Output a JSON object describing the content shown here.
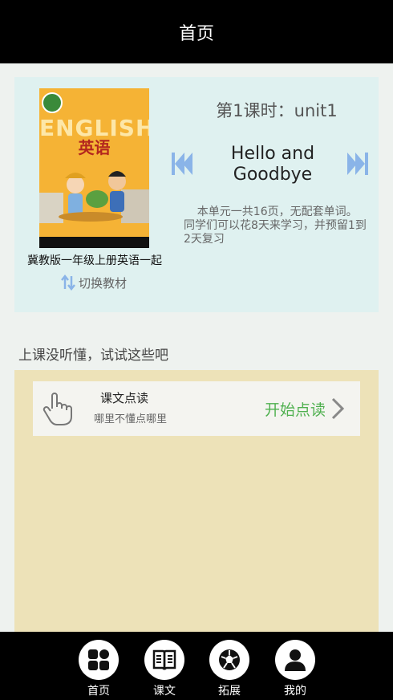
{
  "header": {
    "title": "首页"
  },
  "textbook": {
    "cover_title_en": "ENGLISH",
    "cover_title_cn": "英语",
    "name": "冀教版一年级上册英语一起",
    "switch_label": "切换教材"
  },
  "lesson": {
    "title": "第1课时：unit1",
    "unit_name": "Hello and Goodbye",
    "description": "本单元一共16页，无配套单词。同学们可以花8天来学习，并预留1到2天复习"
  },
  "section": {
    "label": "上课没听懂，试试这些吧"
  },
  "reading": {
    "title": "课文点读",
    "subtitle": "哪里不懂点哪里",
    "action": "开始点读"
  },
  "tabs": [
    {
      "label": "首页",
      "icon": "grid-icon"
    },
    {
      "label": "课文",
      "icon": "book-icon"
    },
    {
      "label": "拓展",
      "icon": "ball-icon"
    },
    {
      "label": "我的",
      "icon": "person-icon"
    }
  ],
  "colors": {
    "accent_green": "#4fb04f",
    "nav_blue": "#8ab4e8",
    "card_bg": "#dff1f0",
    "panel_bg": "#ede2b8"
  }
}
